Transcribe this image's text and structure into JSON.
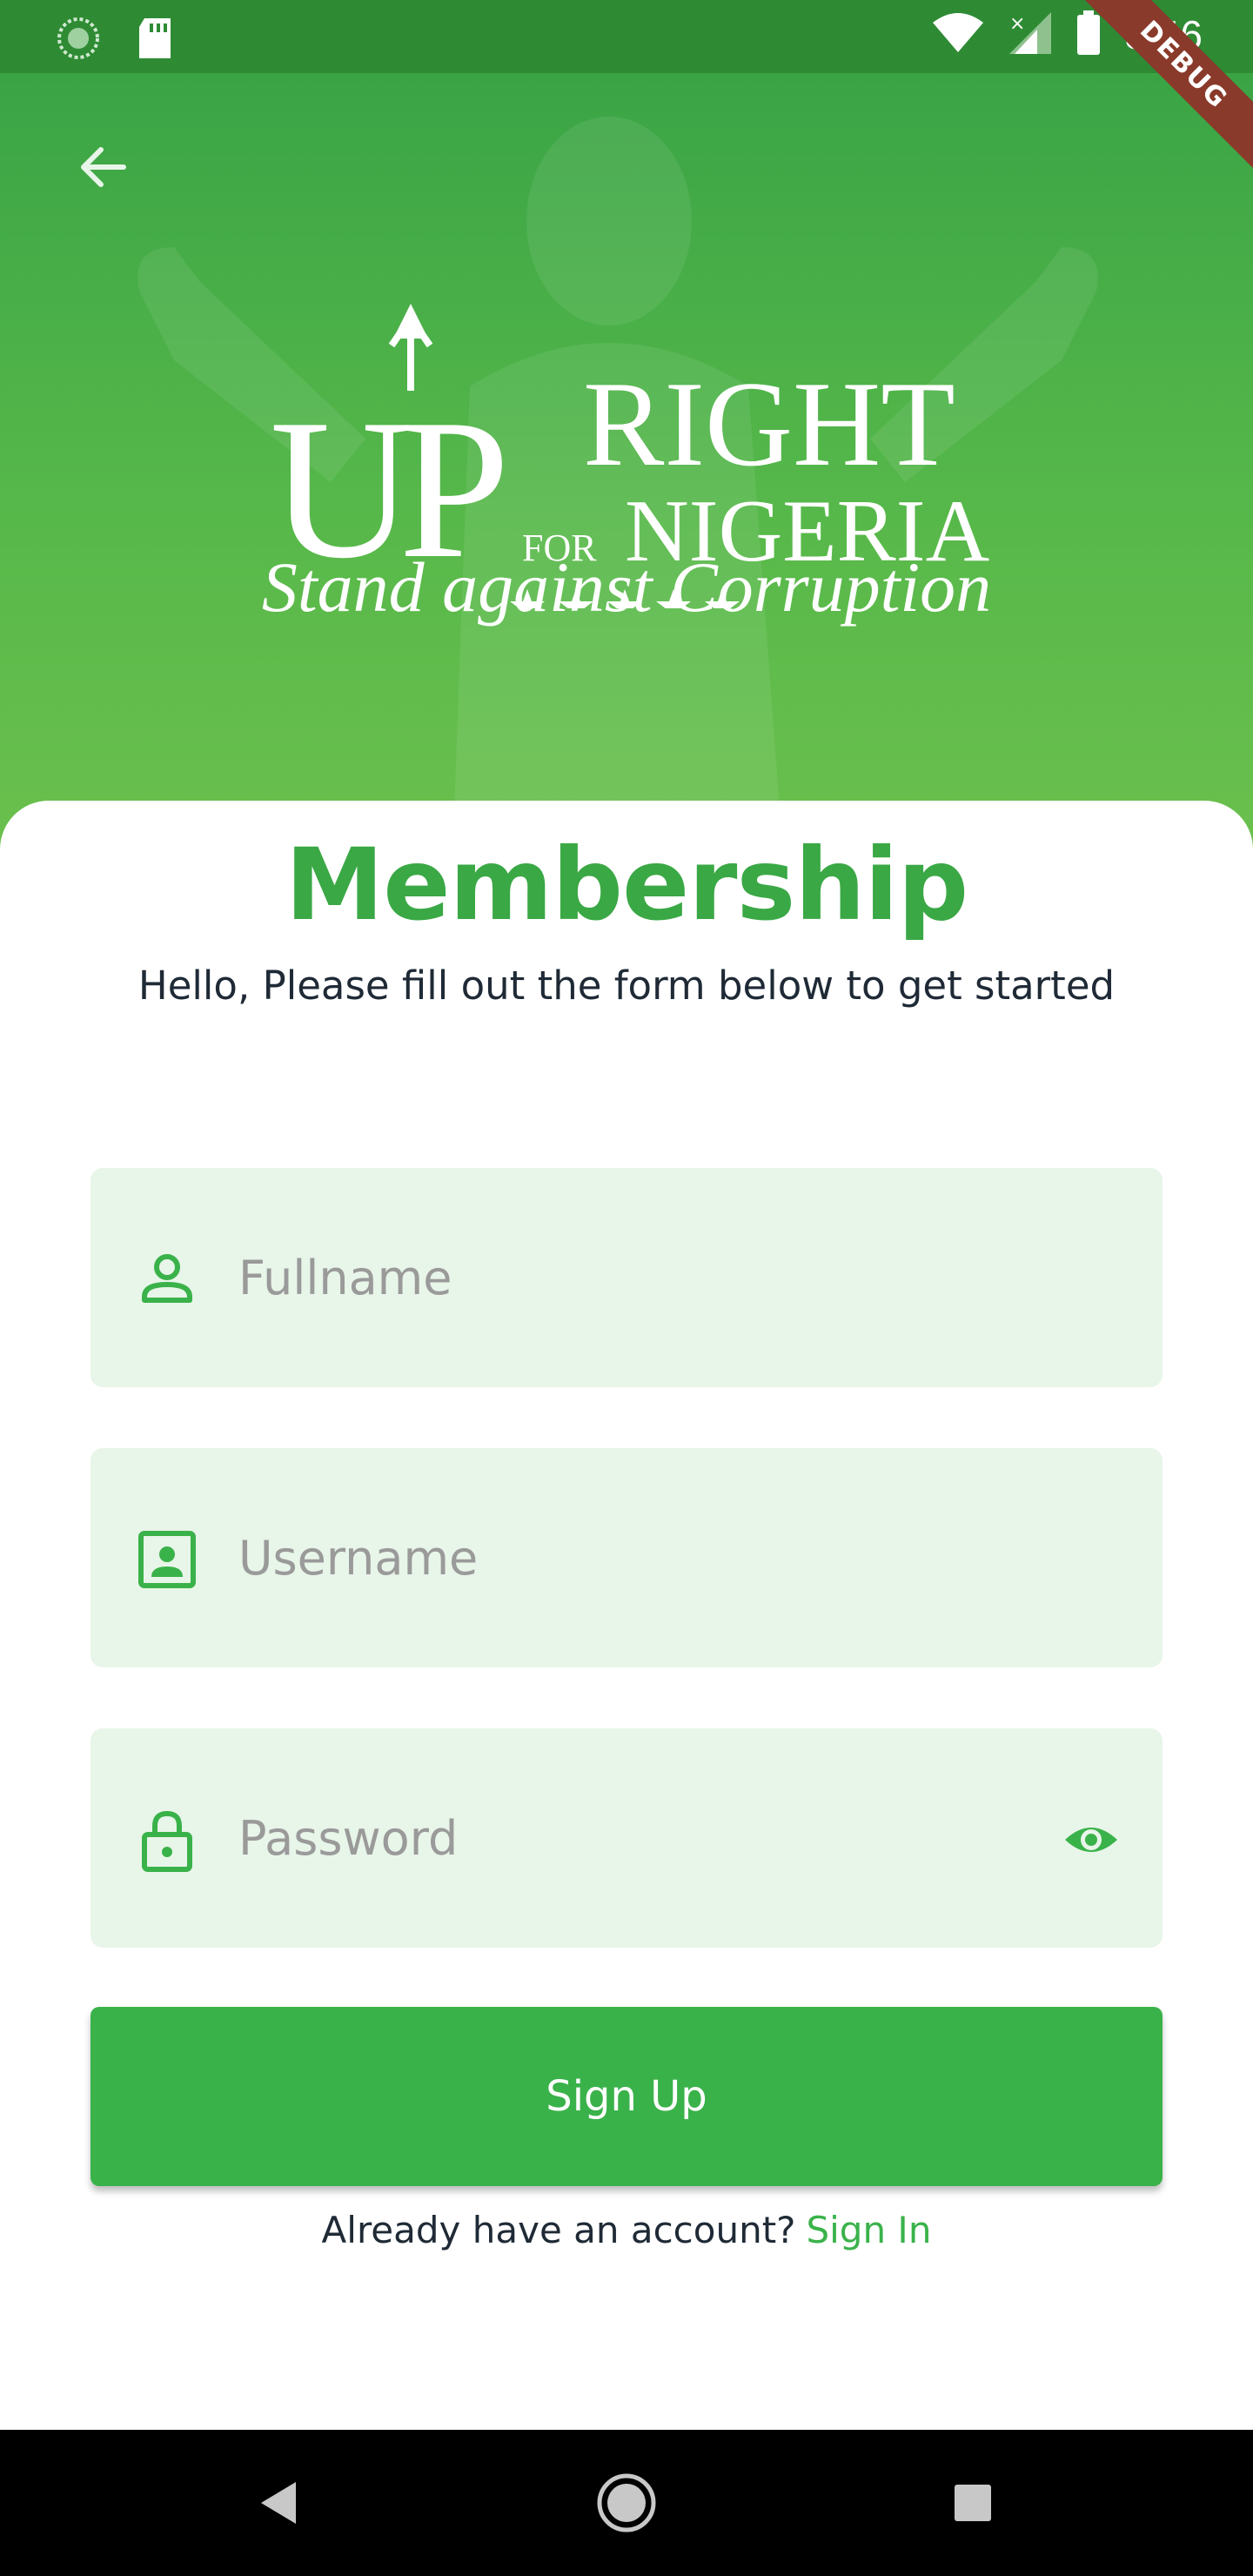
{
  "status_bar": {
    "time": "8:46",
    "debug_label": "DEBUG"
  },
  "header": {
    "back_icon": "arrow-back-icon",
    "logo": {
      "up": "UP",
      "right": "RIGHT",
      "for": "FOR",
      "nigeria": "NIGERIA",
      "stars": 5,
      "tagline": "Stand against Corruption"
    }
  },
  "form": {
    "title": "Membership",
    "subtitle": "Hello, Please fill out the form below to get started",
    "fullname": {
      "placeholder": "Fullname",
      "value": "",
      "icon": "person-icon"
    },
    "username": {
      "placeholder": "Username",
      "value": "",
      "icon": "account-box-icon"
    },
    "password": {
      "placeholder": "Password",
      "value": "",
      "icon": "lock-icon",
      "toggle_icon": "eye-icon"
    },
    "signup_label": "Sign Up",
    "already_text": "Already have an account?",
    "signin_label": "Sign In"
  },
  "colors": {
    "primary": "#3ab24a",
    "field_bg": "#e8f5e9",
    "status_bar": "#2e8b34",
    "text_dark": "#1f2a36"
  },
  "nav": {
    "back_icon": "triangle-back-icon",
    "home_icon": "circle-home-icon",
    "recents_icon": "square-recents-icon"
  }
}
